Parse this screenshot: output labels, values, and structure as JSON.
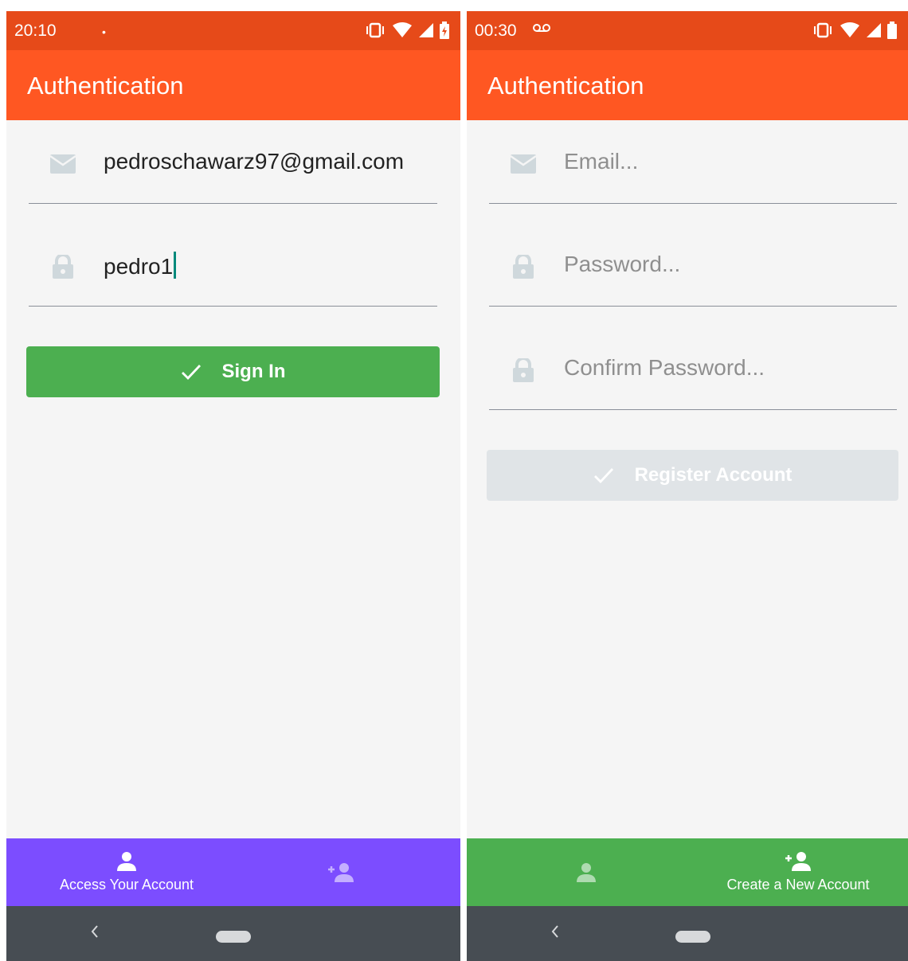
{
  "colors": {
    "status_bar": "#e64a19",
    "app_bar": "#ff5722",
    "sign_in_button": "#4caf50",
    "register_button_disabled": "#e0e4e7",
    "bottom_nav_left": "#7c4dff",
    "bottom_nav_right": "#4caf50",
    "system_nav": "#474d53",
    "input_icon": "#cfd8dc"
  },
  "left": {
    "status": {
      "time": "20:10",
      "extra": "•"
    },
    "app_title": "Authentication",
    "email": {
      "value": "pedroschawarz97@gmail.com",
      "icon": "email-icon"
    },
    "password": {
      "value": "pedro1",
      "icon": "lock-icon"
    },
    "sign_in": {
      "label": "Sign In",
      "icon": "check-icon"
    },
    "bottom_nav": {
      "access_label": "Access Your Account",
      "access_icon": "person-icon",
      "create_icon": "person-add-icon"
    }
  },
  "right": {
    "status": {
      "time": "00:30",
      "extra": "voicemail-icon"
    },
    "app_title": "Authentication",
    "email": {
      "placeholder": "Email...",
      "icon": "email-icon"
    },
    "password": {
      "placeholder": "Password...",
      "icon": "lock-icon"
    },
    "confirm_password": {
      "placeholder": "Confirm Password...",
      "icon": "lock-icon"
    },
    "register": {
      "label": "Register Account",
      "icon": "check-icon"
    },
    "bottom_nav": {
      "create_label": "Create a New Account",
      "access_icon": "person-icon",
      "create_icon": "person-add-icon"
    }
  }
}
